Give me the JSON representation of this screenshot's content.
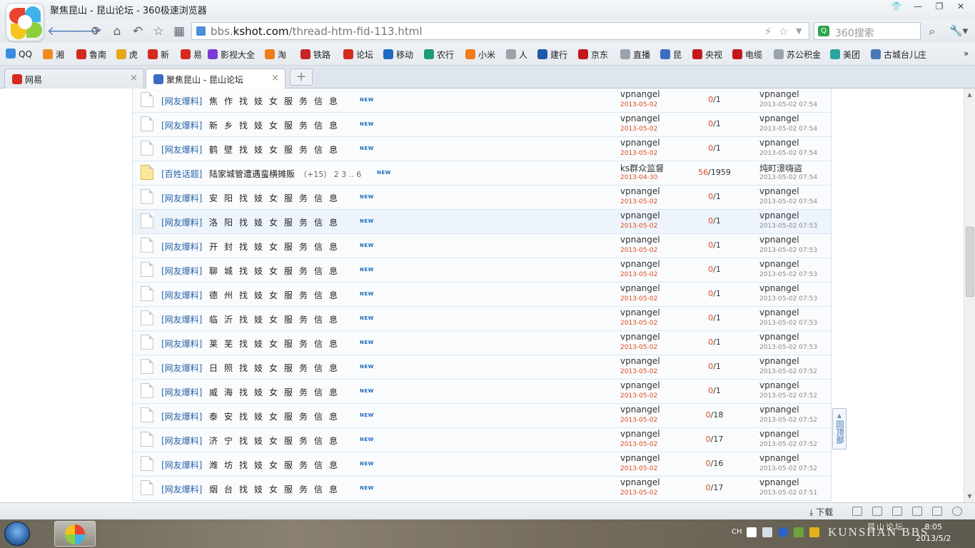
{
  "window": {
    "title": "聚焦昆山 - 昆山论坛 - 360极速浏览器",
    "buttons": [
      "👕",
      "—",
      "❐",
      "✕"
    ]
  },
  "nav": {
    "url_host_prefix": "bbs.",
    "url_host_main": "kshot.com",
    "url_path": "/thread-htm-fid-113.html",
    "search_placeholder": "360搜索"
  },
  "bookmarks": [
    {
      "label": "QQ",
      "color": "#3a8de0"
    },
    {
      "label": "湘",
      "color": "#f08a1c"
    },
    {
      "label": "鲁南",
      "color": "#d52a1f"
    },
    {
      "label": "虎",
      "color": "#e7a51c"
    },
    {
      "label": "新",
      "color": "#d52a1f"
    },
    {
      "label": "易",
      "color": "#d52a1f"
    },
    {
      "label": "影视大全",
      "color": "#7d3bd6"
    },
    {
      "label": "淘",
      "color": "#f07b16"
    },
    {
      "label": "铁路",
      "color": "#c6252a"
    },
    {
      "label": "论坛",
      "color": "#d52a1f"
    },
    {
      "label": "移动",
      "color": "#1f6bbd"
    },
    {
      "label": "农行",
      "color": "#1a9b76"
    },
    {
      "label": "小米",
      "color": "#f47a1a"
    },
    {
      "label": "人",
      "color": "#9aa3ac"
    },
    {
      "label": "建行",
      "color": "#1f5aa8"
    },
    {
      "label": "京东",
      "color": "#c4171d"
    },
    {
      "label": "直播",
      "color": "#9aa3ac"
    },
    {
      "label": "昆",
      "color": "#3a6dc2"
    },
    {
      "label": "央视",
      "color": "#c4171d"
    },
    {
      "label": "电缆",
      "color": "#c4171d"
    },
    {
      "label": "苏公积金",
      "color": "#9aa3ac"
    },
    {
      "label": "美团",
      "color": "#2aa5a0"
    },
    {
      "label": "古城台儿庄",
      "color": "#4a77b6"
    }
  ],
  "tabs": [
    {
      "label": "网易",
      "active": false
    },
    {
      "label": "聚焦昆山 - 昆山论坛",
      "active": true
    }
  ],
  "threads": [
    {
      "category": "[网友爆料]",
      "title": "焦作找妓女服务信息",
      "author": "vpnangel",
      "date": "2013-05-02",
      "replies": "0",
      "views": "1",
      "last_user": "vpnangel",
      "last_time": "2013-05-02 07:54"
    },
    {
      "category": "[网友爆料]",
      "title": "新乡找妓女服务信息",
      "author": "vpnangel",
      "date": "2013-05-02",
      "replies": "0",
      "views": "1",
      "last_user": "vpnangel",
      "last_time": "2013-05-02 07:54"
    },
    {
      "category": "[网友爆料]",
      "title": "鹤壁找妓女服务信息",
      "author": "vpnangel",
      "date": "2013-05-02",
      "replies": "0",
      "views": "1",
      "last_user": "vpnangel",
      "last_time": "2013-05-02 07:54"
    },
    {
      "category": "[百姓话题]",
      "title": "陆家城管遭遇蛮横摊贩",
      "extra": "（+15）  2 3 .. 6",
      "author": "ks群众监督",
      "date": "2013-04-30",
      "replies": "56",
      "views": "1959",
      "last_user": "炖町澋嗨盜",
      "last_time": "2013-05-02 07:54",
      "hot": true
    },
    {
      "category": "[网友爆料]",
      "title": "安阳找妓女服务信息",
      "author": "vpnangel",
      "date": "2013-05-02",
      "replies": "0",
      "views": "1",
      "last_user": "vpnangel",
      "last_time": "2013-05-02 07:54"
    },
    {
      "category": "[网友爆料]",
      "title": "洛阳找妓女服务信息",
      "author": "vpnangel",
      "date": "2013-05-02",
      "replies": "0",
      "views": "1",
      "last_user": "vpnangel",
      "last_time": "2013-05-02 07:53",
      "highlight": true
    },
    {
      "category": "[网友爆料]",
      "title": "开封找妓女服务信息",
      "author": "vpnangel",
      "date": "2013-05-02",
      "replies": "0",
      "views": "1",
      "last_user": "vpnangel",
      "last_time": "2013-05-02 07:53"
    },
    {
      "category": "[网友爆料]",
      "title": "聊城找妓女服务信息",
      "author": "vpnangel",
      "date": "2013-05-02",
      "replies": "0",
      "views": "1",
      "last_user": "vpnangel",
      "last_time": "2013-05-02 07:53"
    },
    {
      "category": "[网友爆料]",
      "title": "德州找妓女服务信息",
      "author": "vpnangel",
      "date": "2013-05-02",
      "replies": "0",
      "views": "1",
      "last_user": "vpnangel",
      "last_time": "2013-05-02 07:53"
    },
    {
      "category": "[网友爆料]",
      "title": "临沂找妓女服务信息",
      "author": "vpnangel",
      "date": "2013-05-02",
      "replies": "0",
      "views": "1",
      "last_user": "vpnangel",
      "last_time": "2013-05-02 07:53"
    },
    {
      "category": "[网友爆料]",
      "title": "莱芜找妓女服务信息",
      "author": "vpnangel",
      "date": "2013-05-02",
      "replies": "0",
      "views": "1",
      "last_user": "vpnangel",
      "last_time": "2013-05-02 07:53"
    },
    {
      "category": "[网友爆料]",
      "title": "日照找妓女服务信息",
      "author": "vpnangel",
      "date": "2013-05-02",
      "replies": "0",
      "views": "1",
      "last_user": "vpnangel",
      "last_time": "2013-05-02 07:52"
    },
    {
      "category": "[网友爆料]",
      "title": "威海找妓女服务信息",
      "author": "vpnangel",
      "date": "2013-05-02",
      "replies": "0",
      "views": "1",
      "last_user": "vpnangel",
      "last_time": "2013-05-02 07:52"
    },
    {
      "category": "[网友爆料]",
      "title": "泰安找妓女服务信息",
      "author": "vpnangel",
      "date": "2013-05-02",
      "replies": "0",
      "views": "18",
      "last_user": "vpnangel",
      "last_time": "2013-05-02 07:52"
    },
    {
      "category": "[网友爆料]",
      "title": "济宁找妓女服务信息",
      "author": "vpnangel",
      "date": "2013-05-02",
      "replies": "0",
      "views": "17",
      "last_user": "vpnangel",
      "last_time": "2013-05-02 07:52"
    },
    {
      "category": "[网友爆料]",
      "title": "潍坊找妓女服务信息",
      "author": "vpnangel",
      "date": "2013-05-02",
      "replies": "0",
      "views": "16",
      "last_user": "vpnangel",
      "last_time": "2013-05-02 07:52"
    },
    {
      "category": "[网友爆料]",
      "title": "烟台找妓女服务信息",
      "author": "vpnangel",
      "date": "2013-05-02",
      "replies": "0",
      "views": "17",
      "last_user": "vpnangel",
      "last_time": "2013-05-02 07:51"
    }
  ],
  "new_badge": "NEW",
  "back_to_top": "回顶部",
  "statusbar": {
    "download_label": "下载"
  },
  "taskbar": {
    "lang": "CH",
    "clock_time": "8:05",
    "clock_date": "2013/5/2",
    "watermark": "KUNSHAN BBS",
    "watermark_cn": "昆山论坛"
  }
}
